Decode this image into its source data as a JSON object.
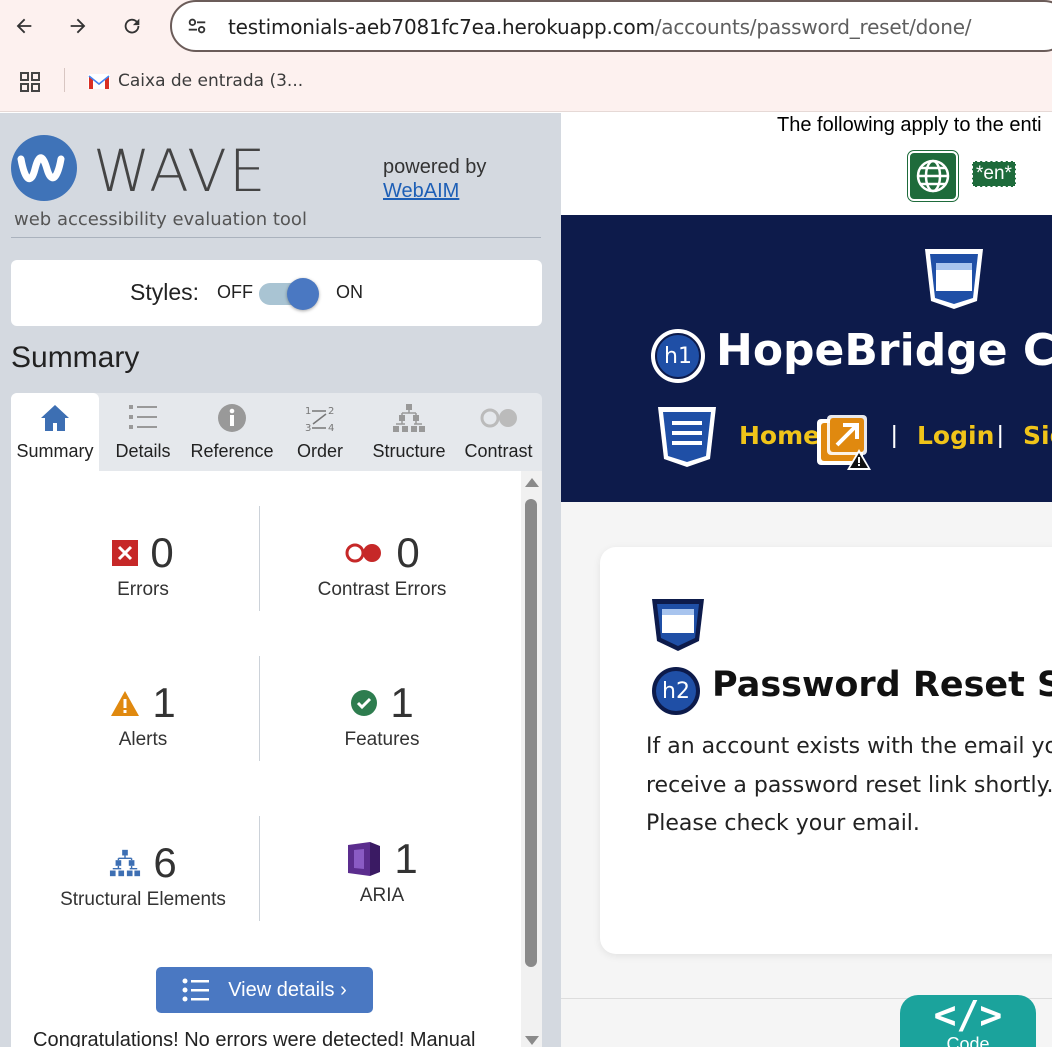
{
  "browser": {
    "url_host": "testimonials-aeb7081fc7ea.herokuapp.com",
    "url_path": "/accounts/password_reset/done/",
    "bookmarks": [
      {
        "label": "Caixa de entrada (3..."
      }
    ]
  },
  "wave": {
    "brand": "WAVE",
    "tagline": "web accessibility evaluation tool",
    "powered_by": "powered by",
    "powered_link": "WebAIM",
    "styles_label": "Styles:",
    "styles_off": "OFF",
    "styles_on": "ON",
    "styles_state": "on",
    "summary_heading": "Summary",
    "tabs": [
      {
        "label": "Summary",
        "icon": "home-icon",
        "active": true
      },
      {
        "label": "Details",
        "icon": "list-icon"
      },
      {
        "label": "Reference",
        "icon": "info-icon"
      },
      {
        "label": "Order",
        "icon": "order-icon"
      },
      {
        "label": "Structure",
        "icon": "structure-icon"
      },
      {
        "label": "Contrast",
        "icon": "contrast-icon"
      }
    ],
    "stats": {
      "errors": {
        "count": "0",
        "label": "Errors"
      },
      "contrast_errors": {
        "count": "0",
        "label": "Contrast Errors"
      },
      "alerts": {
        "count": "1",
        "label": "Alerts"
      },
      "features": {
        "count": "1",
        "label": "Features"
      },
      "structural": {
        "count": "6",
        "label": "Structural Elements"
      },
      "aria": {
        "count": "1",
        "label": "ARIA"
      }
    },
    "view_details": "View details ›",
    "congrats": "Congratulations! No errors were detected! Manual"
  },
  "page": {
    "lang_notice": "The following apply to the enti",
    "lang_badge": "*en*",
    "site_title": "HopeBridge Co",
    "nav": [
      "Home",
      "Login",
      "Sig"
    ],
    "h1_badge": "h1",
    "h2_badge": "h2",
    "card_title": "Password Reset Sent",
    "card_lines": [
      "If an account exists with the email you",
      "receive a password reset link shortly.",
      "Please check your email."
    ],
    "code_symbol": "</>",
    "code_label": "Code"
  },
  "colors": {
    "wave_blue": "#4a78c2",
    "nav_bg": "#0d1b4b",
    "nav_link": "#f0c419",
    "error_red": "#c62828",
    "alert_orange": "#e0890f",
    "feature_green": "#2e7d4f",
    "aria_purple": "#5b2d8e"
  }
}
